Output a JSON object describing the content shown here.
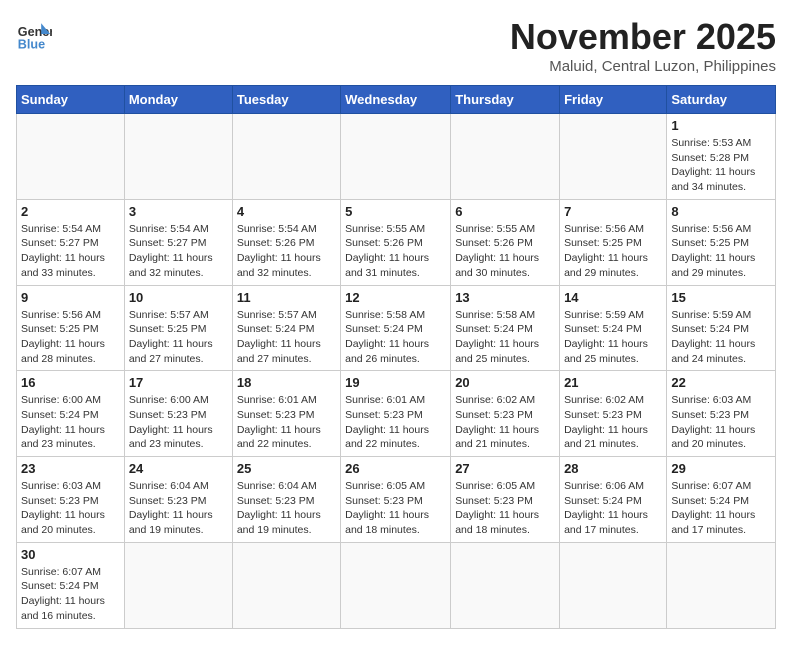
{
  "header": {
    "logo_line1": "General",
    "logo_line2": "Blue",
    "title": "November 2025",
    "subtitle": "Maluid, Central Luzon, Philippines"
  },
  "weekdays": [
    "Sunday",
    "Monday",
    "Tuesday",
    "Wednesday",
    "Thursday",
    "Friday",
    "Saturday"
  ],
  "weeks": [
    [
      {
        "day": "",
        "info": ""
      },
      {
        "day": "",
        "info": ""
      },
      {
        "day": "",
        "info": ""
      },
      {
        "day": "",
        "info": ""
      },
      {
        "day": "",
        "info": ""
      },
      {
        "day": "",
        "info": ""
      },
      {
        "day": "1",
        "info": "Sunrise: 5:53 AM\nSunset: 5:28 PM\nDaylight: 11 hours\nand 34 minutes."
      }
    ],
    [
      {
        "day": "2",
        "info": "Sunrise: 5:54 AM\nSunset: 5:27 PM\nDaylight: 11 hours\nand 33 minutes."
      },
      {
        "day": "3",
        "info": "Sunrise: 5:54 AM\nSunset: 5:27 PM\nDaylight: 11 hours\nand 32 minutes."
      },
      {
        "day": "4",
        "info": "Sunrise: 5:54 AM\nSunset: 5:26 PM\nDaylight: 11 hours\nand 32 minutes."
      },
      {
        "day": "5",
        "info": "Sunrise: 5:55 AM\nSunset: 5:26 PM\nDaylight: 11 hours\nand 31 minutes."
      },
      {
        "day": "6",
        "info": "Sunrise: 5:55 AM\nSunset: 5:26 PM\nDaylight: 11 hours\nand 30 minutes."
      },
      {
        "day": "7",
        "info": "Sunrise: 5:56 AM\nSunset: 5:25 PM\nDaylight: 11 hours\nand 29 minutes."
      },
      {
        "day": "8",
        "info": "Sunrise: 5:56 AM\nSunset: 5:25 PM\nDaylight: 11 hours\nand 29 minutes."
      }
    ],
    [
      {
        "day": "9",
        "info": "Sunrise: 5:56 AM\nSunset: 5:25 PM\nDaylight: 11 hours\nand 28 minutes."
      },
      {
        "day": "10",
        "info": "Sunrise: 5:57 AM\nSunset: 5:25 PM\nDaylight: 11 hours\nand 27 minutes."
      },
      {
        "day": "11",
        "info": "Sunrise: 5:57 AM\nSunset: 5:24 PM\nDaylight: 11 hours\nand 27 minutes."
      },
      {
        "day": "12",
        "info": "Sunrise: 5:58 AM\nSunset: 5:24 PM\nDaylight: 11 hours\nand 26 minutes."
      },
      {
        "day": "13",
        "info": "Sunrise: 5:58 AM\nSunset: 5:24 PM\nDaylight: 11 hours\nand 25 minutes."
      },
      {
        "day": "14",
        "info": "Sunrise: 5:59 AM\nSunset: 5:24 PM\nDaylight: 11 hours\nand 25 minutes."
      },
      {
        "day": "15",
        "info": "Sunrise: 5:59 AM\nSunset: 5:24 PM\nDaylight: 11 hours\nand 24 minutes."
      }
    ],
    [
      {
        "day": "16",
        "info": "Sunrise: 6:00 AM\nSunset: 5:24 PM\nDaylight: 11 hours\nand 23 minutes."
      },
      {
        "day": "17",
        "info": "Sunrise: 6:00 AM\nSunset: 5:23 PM\nDaylight: 11 hours\nand 23 minutes."
      },
      {
        "day": "18",
        "info": "Sunrise: 6:01 AM\nSunset: 5:23 PM\nDaylight: 11 hours\nand 22 minutes."
      },
      {
        "day": "19",
        "info": "Sunrise: 6:01 AM\nSunset: 5:23 PM\nDaylight: 11 hours\nand 22 minutes."
      },
      {
        "day": "20",
        "info": "Sunrise: 6:02 AM\nSunset: 5:23 PM\nDaylight: 11 hours\nand 21 minutes."
      },
      {
        "day": "21",
        "info": "Sunrise: 6:02 AM\nSunset: 5:23 PM\nDaylight: 11 hours\nand 21 minutes."
      },
      {
        "day": "22",
        "info": "Sunrise: 6:03 AM\nSunset: 5:23 PM\nDaylight: 11 hours\nand 20 minutes."
      }
    ],
    [
      {
        "day": "23",
        "info": "Sunrise: 6:03 AM\nSunset: 5:23 PM\nDaylight: 11 hours\nand 20 minutes."
      },
      {
        "day": "24",
        "info": "Sunrise: 6:04 AM\nSunset: 5:23 PM\nDaylight: 11 hours\nand 19 minutes."
      },
      {
        "day": "25",
        "info": "Sunrise: 6:04 AM\nSunset: 5:23 PM\nDaylight: 11 hours\nand 19 minutes."
      },
      {
        "day": "26",
        "info": "Sunrise: 6:05 AM\nSunset: 5:23 PM\nDaylight: 11 hours\nand 18 minutes."
      },
      {
        "day": "27",
        "info": "Sunrise: 6:05 AM\nSunset: 5:23 PM\nDaylight: 11 hours\nand 18 minutes."
      },
      {
        "day": "28",
        "info": "Sunrise: 6:06 AM\nSunset: 5:24 PM\nDaylight: 11 hours\nand 17 minutes."
      },
      {
        "day": "29",
        "info": "Sunrise: 6:07 AM\nSunset: 5:24 PM\nDaylight: 11 hours\nand 17 minutes."
      }
    ],
    [
      {
        "day": "30",
        "info": "Sunrise: 6:07 AM\nSunset: 5:24 PM\nDaylight: 11 hours\nand 16 minutes."
      },
      {
        "day": "",
        "info": ""
      },
      {
        "day": "",
        "info": ""
      },
      {
        "day": "",
        "info": ""
      },
      {
        "day": "",
        "info": ""
      },
      {
        "day": "",
        "info": ""
      },
      {
        "day": "",
        "info": ""
      }
    ]
  ]
}
